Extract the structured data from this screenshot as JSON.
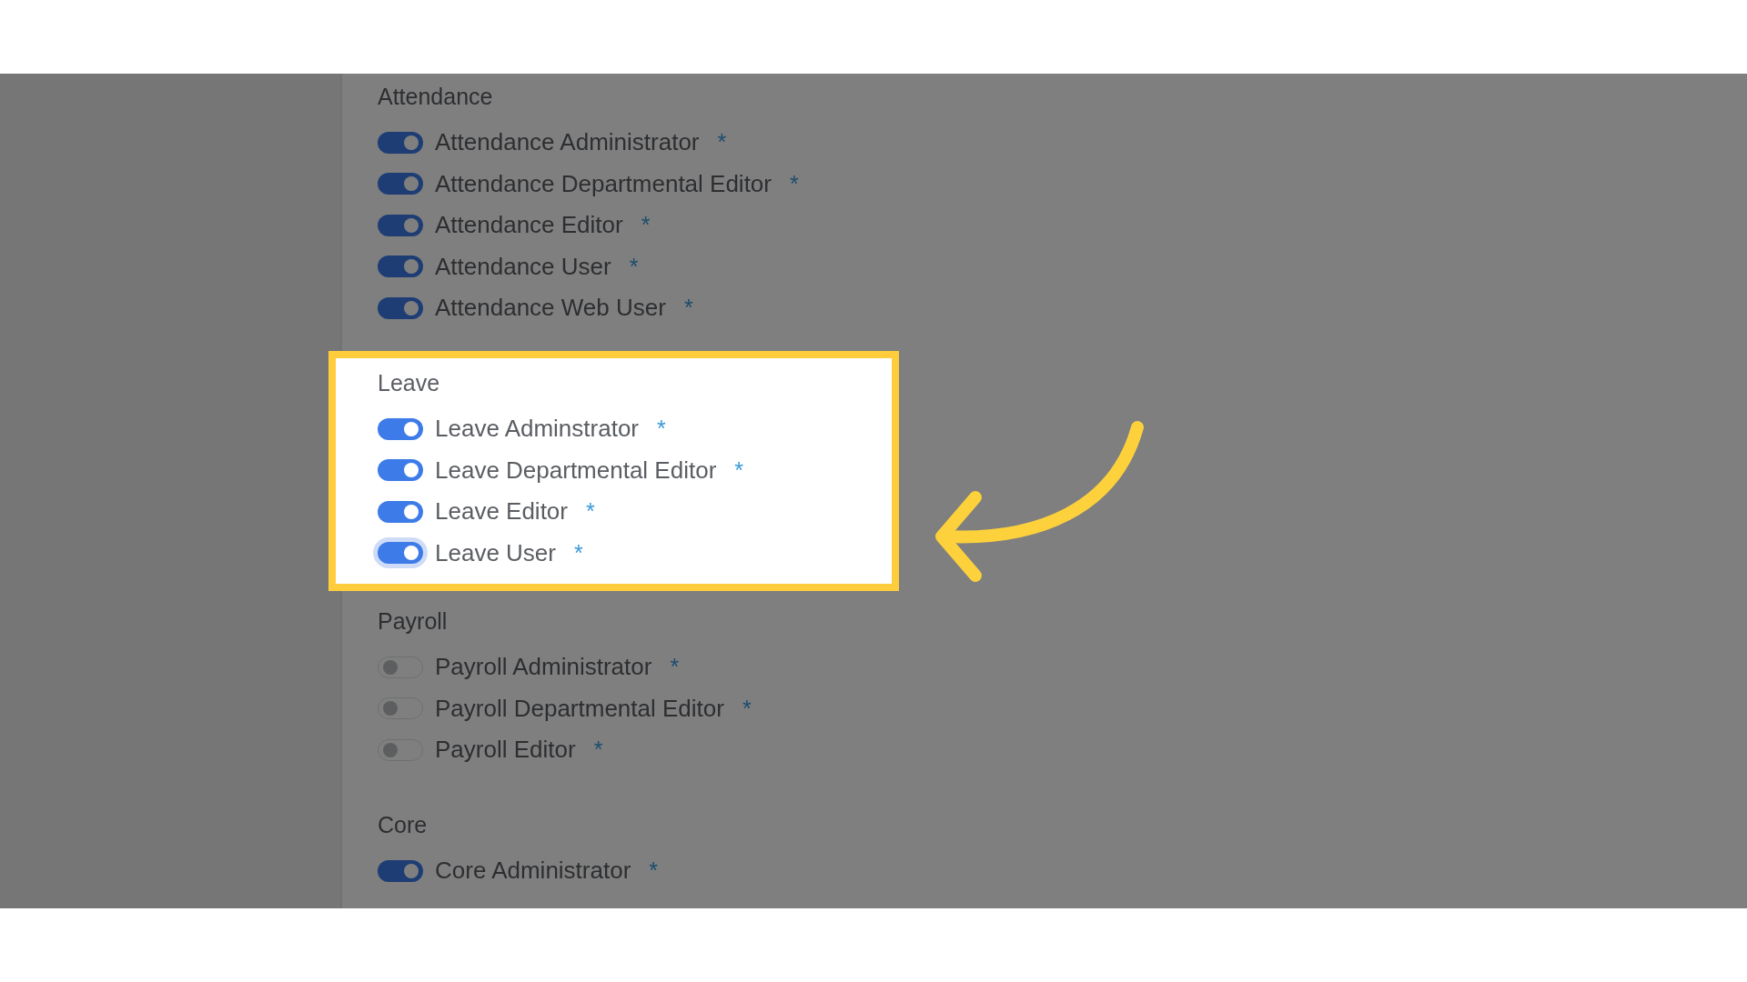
{
  "sections": [
    {
      "title": "Attendance",
      "highlighted": false,
      "roles": [
        {
          "label": "Attendance Administrator",
          "marker": "*",
          "on": true,
          "focused": false
        },
        {
          "label": "Attendance Departmental Editor",
          "marker": "*",
          "on": true,
          "focused": false
        },
        {
          "label": "Attendance Editor",
          "marker": "*",
          "on": true,
          "focused": false
        },
        {
          "label": "Attendance User",
          "marker": "*",
          "on": true,
          "focused": false
        },
        {
          "label": "Attendance Web User",
          "marker": "*",
          "on": true,
          "focused": false
        }
      ]
    },
    {
      "title": "Leave",
      "highlighted": true,
      "roles": [
        {
          "label": "Leave Adminstrator",
          "marker": "*",
          "on": true,
          "focused": false
        },
        {
          "label": "Leave Departmental Editor",
          "marker": "*",
          "on": true,
          "focused": false
        },
        {
          "label": "Leave Editor",
          "marker": "*",
          "on": true,
          "focused": false
        },
        {
          "label": "Leave User",
          "marker": "*",
          "on": true,
          "focused": true
        }
      ]
    },
    {
      "title": "Payroll",
      "highlighted": false,
      "roles": [
        {
          "label": "Payroll Administrator",
          "marker": "*",
          "on": false,
          "focused": false
        },
        {
          "label": "Payroll Departmental Editor",
          "marker": "*",
          "on": false,
          "focused": false
        },
        {
          "label": "Payroll Editor",
          "marker": "*",
          "on": false,
          "focused": false
        }
      ]
    },
    {
      "title": "Core",
      "highlighted": false,
      "roles": [
        {
          "label": "Core Administrator",
          "marker": "*",
          "on": true,
          "focused": false
        }
      ]
    }
  ]
}
